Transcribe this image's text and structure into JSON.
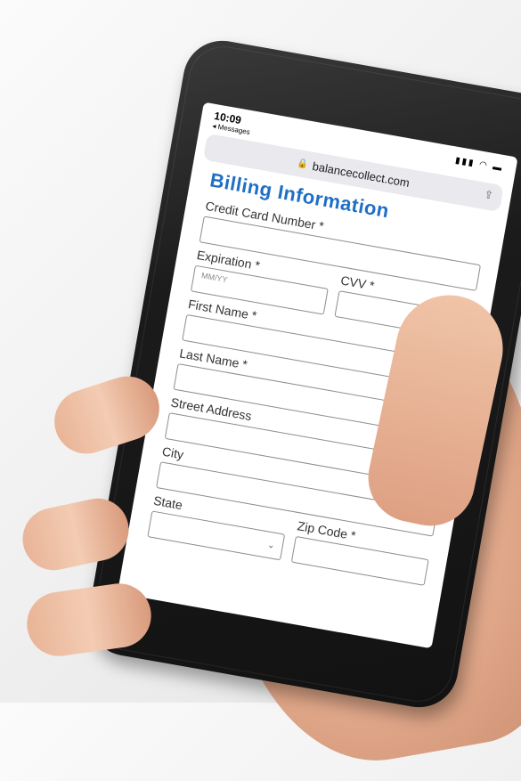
{
  "status_bar": {
    "time": "10:09",
    "back_app": "◂ Messages",
    "icons": "▮▮▮ ◠ ▬"
  },
  "browser": {
    "url": "balancecollect.com",
    "lock_glyph": "🔒",
    "share_glyph": "⇪"
  },
  "form": {
    "title": "Billing Information",
    "credit_card_label": "Credit Card Number *",
    "expiration_label": "Expiration *",
    "expiration_placeholder": "MM/YY",
    "cvv_label": "CVV *",
    "first_name_label": "First Name *",
    "last_name_label": "Last Name *",
    "street_label": "Street Address",
    "city_label": "City",
    "state_label": "State",
    "zip_label": "Zip Code *"
  },
  "colors": {
    "title_blue": "#1f6fc6",
    "phone_body": "#1b1b1b"
  }
}
